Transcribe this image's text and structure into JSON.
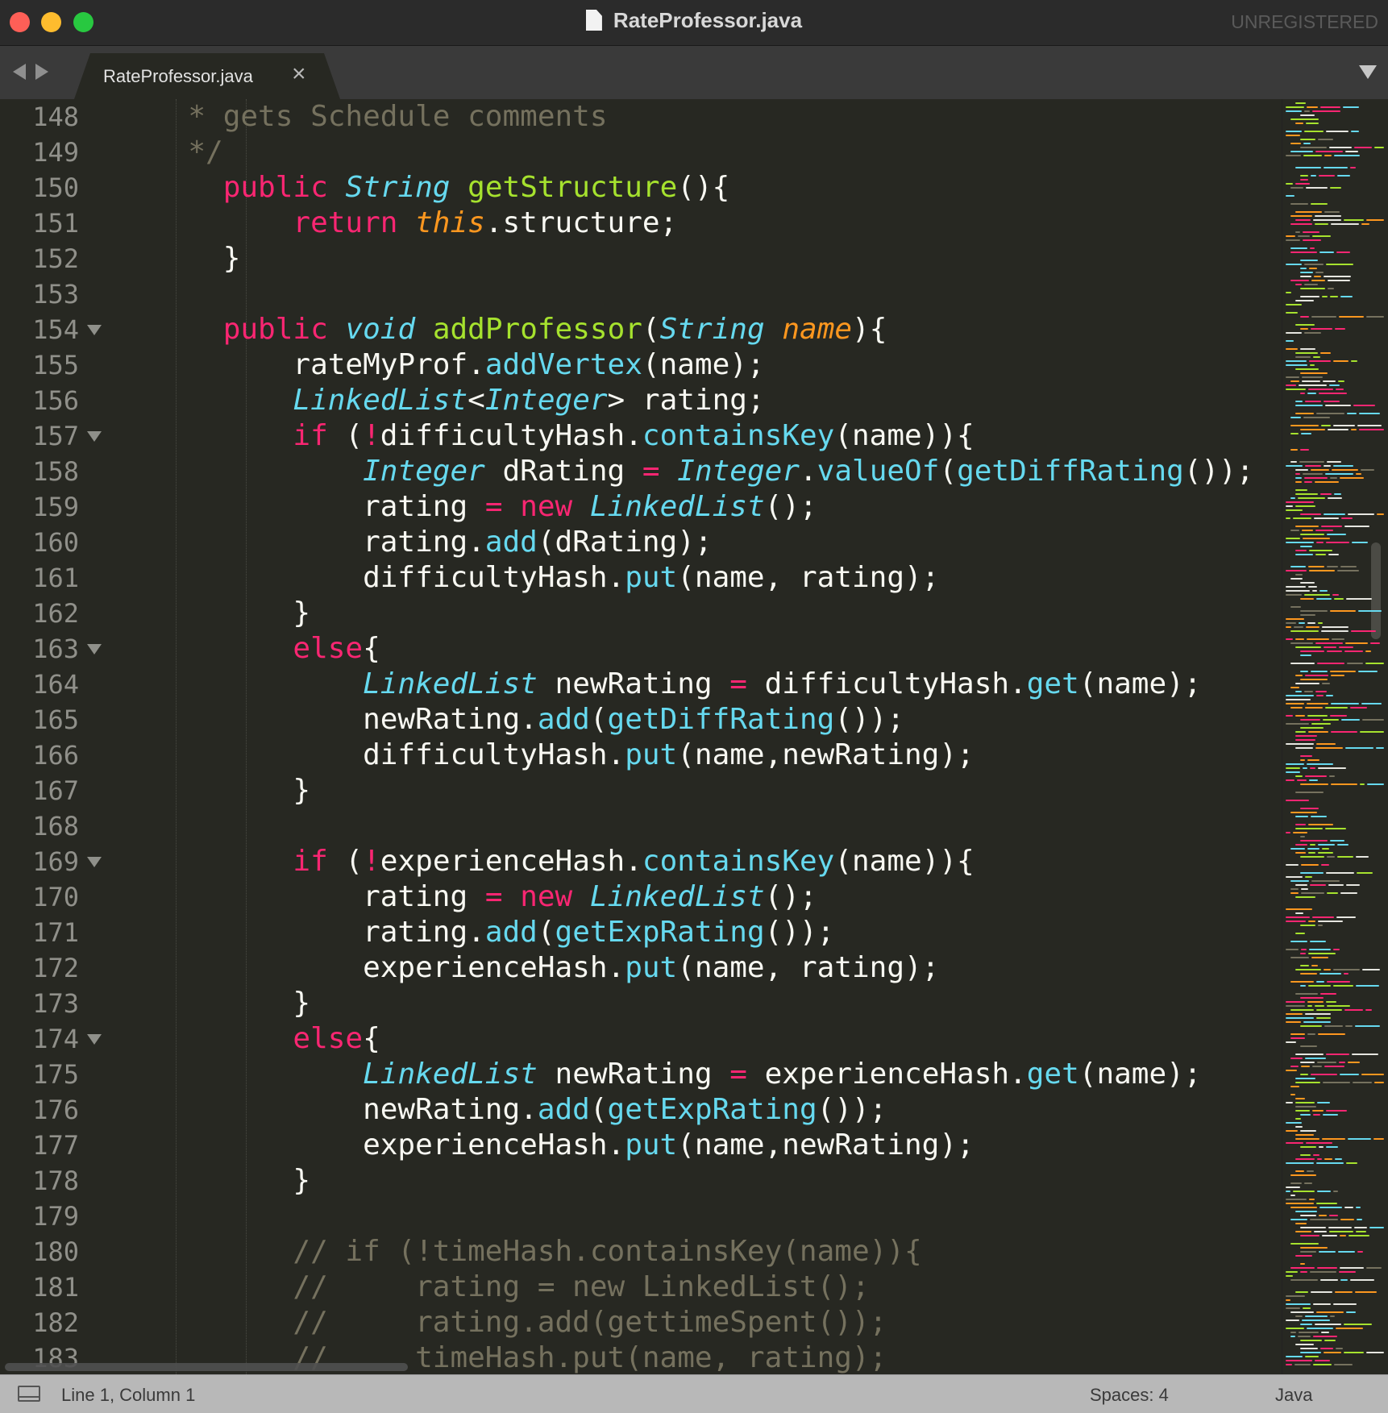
{
  "window": {
    "title": "RateProfessor.java",
    "unregistered_label": "UNREGISTERED"
  },
  "tabs": [
    {
      "label": "RateProfessor.java",
      "close_glyph": "×",
      "active": true
    }
  ],
  "editor": {
    "language": "Java",
    "first_line_number": 148,
    "lines": [
      {
        "n": "148",
        "fold": false,
        "indent": 2,
        "tokens": [
          [
            "cm",
            "  * gets Schedule comments"
          ]
        ]
      },
      {
        "n": "149",
        "fold": false,
        "indent": 2,
        "tokens": [
          [
            "cm",
            "  */"
          ]
        ]
      },
      {
        "n": "150",
        "fold": false,
        "indent": 1,
        "tokens": [
          [
            "",
            "    "
          ],
          [
            "kw",
            "public"
          ],
          [
            "",
            " "
          ],
          [
            "ty",
            "String"
          ],
          [
            "",
            " "
          ],
          [
            "fn",
            "getStructure"
          ],
          [
            "",
            "(){"
          ]
        ]
      },
      {
        "n": "151",
        "fold": false,
        "indent": 2,
        "tokens": [
          [
            "",
            "        "
          ],
          [
            "kw",
            "return"
          ],
          [
            "",
            " "
          ],
          [
            "this",
            "this"
          ],
          [
            "",
            ".structure;"
          ]
        ]
      },
      {
        "n": "152",
        "fold": false,
        "indent": 1,
        "tokens": [
          [
            "",
            "    }"
          ]
        ]
      },
      {
        "n": "153",
        "fold": false,
        "indent": 0,
        "tokens": [
          [
            "",
            ""
          ]
        ]
      },
      {
        "n": "154",
        "fold": true,
        "indent": 1,
        "tokens": [
          [
            "",
            "    "
          ],
          [
            "kw",
            "public"
          ],
          [
            "",
            " "
          ],
          [
            "ty",
            "void"
          ],
          [
            "",
            " "
          ],
          [
            "fn",
            "addProfessor"
          ],
          [
            "",
            "("
          ],
          [
            "ty",
            "String"
          ],
          [
            "",
            " "
          ],
          [
            "arg",
            "name"
          ],
          [
            "",
            "){"
          ]
        ]
      },
      {
        "n": "155",
        "fold": false,
        "indent": 2,
        "tokens": [
          [
            "",
            "        rateMyProf."
          ],
          [
            "call",
            "addVertex"
          ],
          [
            "",
            "(name);"
          ]
        ]
      },
      {
        "n": "156",
        "fold": false,
        "indent": 2,
        "tokens": [
          [
            "",
            "        "
          ],
          [
            "ty",
            "LinkedList"
          ],
          [
            "",
            "<"
          ],
          [
            "ty",
            "Integer"
          ],
          [
            "",
            "> rating;"
          ]
        ]
      },
      {
        "n": "157",
        "fold": true,
        "indent": 2,
        "tokens": [
          [
            "",
            "        "
          ],
          [
            "kw",
            "if"
          ],
          [
            "",
            " ("
          ],
          [
            "op",
            "!"
          ],
          [
            "",
            "difficultyHash."
          ],
          [
            "call",
            "containsKey"
          ],
          [
            "",
            "(name)){"
          ]
        ]
      },
      {
        "n": "158",
        "fold": false,
        "indent": 3,
        "tokens": [
          [
            "",
            "            "
          ],
          [
            "ty",
            "Integer"
          ],
          [
            "",
            " dRating "
          ],
          [
            "op",
            "="
          ],
          [
            "",
            " "
          ],
          [
            "ty",
            "Integer"
          ],
          [
            "",
            "."
          ],
          [
            "call",
            "valueOf"
          ],
          [
            "",
            "("
          ],
          [
            "call",
            "getDiffRating"
          ],
          [
            "",
            "());"
          ]
        ]
      },
      {
        "n": "159",
        "fold": false,
        "indent": 3,
        "tokens": [
          [
            "",
            "            rating "
          ],
          [
            "op",
            "="
          ],
          [
            "",
            " "
          ],
          [
            "kw",
            "new"
          ],
          [
            "",
            " "
          ],
          [
            "ty",
            "LinkedList"
          ],
          [
            "",
            "();"
          ]
        ]
      },
      {
        "n": "160",
        "fold": false,
        "indent": 3,
        "tokens": [
          [
            "",
            "            rating."
          ],
          [
            "call",
            "add"
          ],
          [
            "",
            "(dRating);"
          ]
        ]
      },
      {
        "n": "161",
        "fold": false,
        "indent": 3,
        "tokens": [
          [
            "",
            "            difficultyHash."
          ],
          [
            "call",
            "put"
          ],
          [
            "",
            "(name, rating);"
          ]
        ]
      },
      {
        "n": "162",
        "fold": false,
        "indent": 2,
        "tokens": [
          [
            "",
            "        }"
          ]
        ]
      },
      {
        "n": "163",
        "fold": true,
        "indent": 2,
        "tokens": [
          [
            "",
            "        "
          ],
          [
            "kw",
            "else"
          ],
          [
            "",
            "{"
          ]
        ]
      },
      {
        "n": "164",
        "fold": false,
        "indent": 3,
        "tokens": [
          [
            "",
            "            "
          ],
          [
            "ty",
            "LinkedList"
          ],
          [
            "",
            " newRating "
          ],
          [
            "op",
            "="
          ],
          [
            "",
            " difficultyHash."
          ],
          [
            "call",
            "get"
          ],
          [
            "",
            "(name);"
          ]
        ]
      },
      {
        "n": "165",
        "fold": false,
        "indent": 3,
        "tokens": [
          [
            "",
            "            newRating."
          ],
          [
            "call",
            "add"
          ],
          [
            "",
            "("
          ],
          [
            "call",
            "getDiffRating"
          ],
          [
            "",
            "());"
          ]
        ]
      },
      {
        "n": "166",
        "fold": false,
        "indent": 3,
        "tokens": [
          [
            "",
            "            difficultyHash."
          ],
          [
            "call",
            "put"
          ],
          [
            "",
            "(name,newRating);"
          ]
        ]
      },
      {
        "n": "167",
        "fold": false,
        "indent": 2,
        "tokens": [
          [
            "",
            "        }"
          ]
        ]
      },
      {
        "n": "168",
        "fold": false,
        "indent": 0,
        "tokens": [
          [
            "",
            ""
          ]
        ]
      },
      {
        "n": "169",
        "fold": true,
        "indent": 2,
        "tokens": [
          [
            "",
            "        "
          ],
          [
            "kw",
            "if"
          ],
          [
            "",
            " ("
          ],
          [
            "op",
            "!"
          ],
          [
            "",
            "experienceHash."
          ],
          [
            "call",
            "containsKey"
          ],
          [
            "",
            "(name)){"
          ]
        ]
      },
      {
        "n": "170",
        "fold": false,
        "indent": 3,
        "tokens": [
          [
            "",
            "            rating "
          ],
          [
            "op",
            "="
          ],
          [
            "",
            " "
          ],
          [
            "kw",
            "new"
          ],
          [
            "",
            " "
          ],
          [
            "ty",
            "LinkedList"
          ],
          [
            "",
            "();"
          ]
        ]
      },
      {
        "n": "171",
        "fold": false,
        "indent": 3,
        "tokens": [
          [
            "",
            "            rating."
          ],
          [
            "call",
            "add"
          ],
          [
            "",
            "("
          ],
          [
            "call",
            "getExpRating"
          ],
          [
            "",
            "());"
          ]
        ]
      },
      {
        "n": "172",
        "fold": false,
        "indent": 3,
        "tokens": [
          [
            "",
            "            experienceHash."
          ],
          [
            "call",
            "put"
          ],
          [
            "",
            "(name, rating);"
          ]
        ]
      },
      {
        "n": "173",
        "fold": false,
        "indent": 2,
        "tokens": [
          [
            "",
            "        }"
          ]
        ]
      },
      {
        "n": "174",
        "fold": true,
        "indent": 2,
        "tokens": [
          [
            "",
            "        "
          ],
          [
            "kw",
            "else"
          ],
          [
            "",
            "{"
          ]
        ]
      },
      {
        "n": "175",
        "fold": false,
        "indent": 3,
        "tokens": [
          [
            "",
            "            "
          ],
          [
            "ty",
            "LinkedList"
          ],
          [
            "",
            " newRating "
          ],
          [
            "op",
            "="
          ],
          [
            "",
            " experienceHash."
          ],
          [
            "call",
            "get"
          ],
          [
            "",
            "(name);"
          ]
        ]
      },
      {
        "n": "176",
        "fold": false,
        "indent": 3,
        "tokens": [
          [
            "",
            "            newRating."
          ],
          [
            "call",
            "add"
          ],
          [
            "",
            "("
          ],
          [
            "call",
            "getExpRating"
          ],
          [
            "",
            "());"
          ]
        ]
      },
      {
        "n": "177",
        "fold": false,
        "indent": 3,
        "tokens": [
          [
            "",
            "            experienceHash."
          ],
          [
            "call",
            "put"
          ],
          [
            "",
            "(name,newRating);"
          ]
        ]
      },
      {
        "n": "178",
        "fold": false,
        "indent": 2,
        "tokens": [
          [
            "",
            "        }"
          ]
        ]
      },
      {
        "n": "179",
        "fold": false,
        "indent": 0,
        "tokens": [
          [
            "",
            ""
          ]
        ]
      },
      {
        "n": "180",
        "fold": false,
        "indent": 2,
        "tokens": [
          [
            "",
            "        "
          ],
          [
            "cm",
            "// if (!timeHash.containsKey(name)){"
          ]
        ]
      },
      {
        "n": "181",
        "fold": false,
        "indent": 2,
        "tokens": [
          [
            "",
            "        "
          ],
          [
            "cm",
            "//     rating = new LinkedList();"
          ]
        ]
      },
      {
        "n": "182",
        "fold": false,
        "indent": 2,
        "tokens": [
          [
            "",
            "        "
          ],
          [
            "cm",
            "//     rating.add(gettimeSpent());"
          ]
        ]
      },
      {
        "n": "183",
        "fold": false,
        "indent": 2,
        "tokens": [
          [
            "",
            "        "
          ],
          [
            "cm",
            "//     timeHash.put(name, rating);"
          ]
        ]
      }
    ]
  },
  "status_bar": {
    "position": "Line 1, Column 1",
    "spaces": "Spaces: 4",
    "syntax": "Java"
  },
  "colors": {
    "background": "#272822",
    "keyword": "#f92672",
    "type": "#66d9ef",
    "function": "#a6e22e",
    "argument": "#fd971f",
    "comment": "#75715e",
    "text": "#f8f8f2"
  },
  "icons": {
    "window_controls": [
      "close-icon",
      "minimize-icon",
      "maximize-icon"
    ],
    "file": "file-icon",
    "nav": [
      "arrow-left-icon",
      "arrow-right-icon"
    ],
    "tab_menu": "chevron-down-icon",
    "fold": "fold-triangle-icon",
    "panel": "panel-toggle-icon"
  }
}
